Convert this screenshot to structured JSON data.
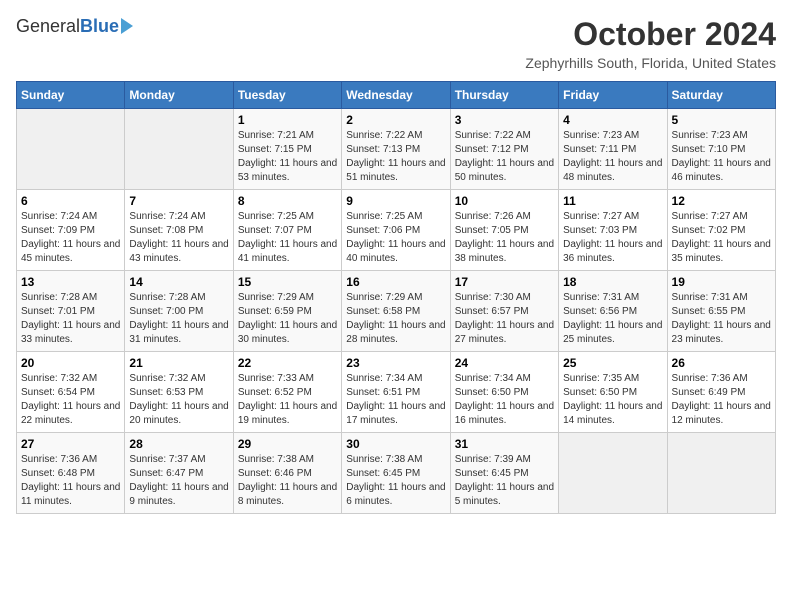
{
  "header": {
    "logo_general": "General",
    "logo_blue": "Blue",
    "month_title": "October 2024",
    "location": "Zephyrhills South, Florida, United States"
  },
  "days_of_week": [
    "Sunday",
    "Monday",
    "Tuesday",
    "Wednesday",
    "Thursday",
    "Friday",
    "Saturday"
  ],
  "weeks": [
    [
      {
        "day": "",
        "info": ""
      },
      {
        "day": "",
        "info": ""
      },
      {
        "day": "1",
        "info": "Sunrise: 7:21 AM\nSunset: 7:15 PM\nDaylight: 11 hours and 53 minutes."
      },
      {
        "day": "2",
        "info": "Sunrise: 7:22 AM\nSunset: 7:13 PM\nDaylight: 11 hours and 51 minutes."
      },
      {
        "day": "3",
        "info": "Sunrise: 7:22 AM\nSunset: 7:12 PM\nDaylight: 11 hours and 50 minutes."
      },
      {
        "day": "4",
        "info": "Sunrise: 7:23 AM\nSunset: 7:11 PM\nDaylight: 11 hours and 48 minutes."
      },
      {
        "day": "5",
        "info": "Sunrise: 7:23 AM\nSunset: 7:10 PM\nDaylight: 11 hours and 46 minutes."
      }
    ],
    [
      {
        "day": "6",
        "info": "Sunrise: 7:24 AM\nSunset: 7:09 PM\nDaylight: 11 hours and 45 minutes."
      },
      {
        "day": "7",
        "info": "Sunrise: 7:24 AM\nSunset: 7:08 PM\nDaylight: 11 hours and 43 minutes."
      },
      {
        "day": "8",
        "info": "Sunrise: 7:25 AM\nSunset: 7:07 PM\nDaylight: 11 hours and 41 minutes."
      },
      {
        "day": "9",
        "info": "Sunrise: 7:25 AM\nSunset: 7:06 PM\nDaylight: 11 hours and 40 minutes."
      },
      {
        "day": "10",
        "info": "Sunrise: 7:26 AM\nSunset: 7:05 PM\nDaylight: 11 hours and 38 minutes."
      },
      {
        "day": "11",
        "info": "Sunrise: 7:27 AM\nSunset: 7:03 PM\nDaylight: 11 hours and 36 minutes."
      },
      {
        "day": "12",
        "info": "Sunrise: 7:27 AM\nSunset: 7:02 PM\nDaylight: 11 hours and 35 minutes."
      }
    ],
    [
      {
        "day": "13",
        "info": "Sunrise: 7:28 AM\nSunset: 7:01 PM\nDaylight: 11 hours and 33 minutes."
      },
      {
        "day": "14",
        "info": "Sunrise: 7:28 AM\nSunset: 7:00 PM\nDaylight: 11 hours and 31 minutes."
      },
      {
        "day": "15",
        "info": "Sunrise: 7:29 AM\nSunset: 6:59 PM\nDaylight: 11 hours and 30 minutes."
      },
      {
        "day": "16",
        "info": "Sunrise: 7:29 AM\nSunset: 6:58 PM\nDaylight: 11 hours and 28 minutes."
      },
      {
        "day": "17",
        "info": "Sunrise: 7:30 AM\nSunset: 6:57 PM\nDaylight: 11 hours and 27 minutes."
      },
      {
        "day": "18",
        "info": "Sunrise: 7:31 AM\nSunset: 6:56 PM\nDaylight: 11 hours and 25 minutes."
      },
      {
        "day": "19",
        "info": "Sunrise: 7:31 AM\nSunset: 6:55 PM\nDaylight: 11 hours and 23 minutes."
      }
    ],
    [
      {
        "day": "20",
        "info": "Sunrise: 7:32 AM\nSunset: 6:54 PM\nDaylight: 11 hours and 22 minutes."
      },
      {
        "day": "21",
        "info": "Sunrise: 7:32 AM\nSunset: 6:53 PM\nDaylight: 11 hours and 20 minutes."
      },
      {
        "day": "22",
        "info": "Sunrise: 7:33 AM\nSunset: 6:52 PM\nDaylight: 11 hours and 19 minutes."
      },
      {
        "day": "23",
        "info": "Sunrise: 7:34 AM\nSunset: 6:51 PM\nDaylight: 11 hours and 17 minutes."
      },
      {
        "day": "24",
        "info": "Sunrise: 7:34 AM\nSunset: 6:50 PM\nDaylight: 11 hours and 16 minutes."
      },
      {
        "day": "25",
        "info": "Sunrise: 7:35 AM\nSunset: 6:50 PM\nDaylight: 11 hours and 14 minutes."
      },
      {
        "day": "26",
        "info": "Sunrise: 7:36 AM\nSunset: 6:49 PM\nDaylight: 11 hours and 12 minutes."
      }
    ],
    [
      {
        "day": "27",
        "info": "Sunrise: 7:36 AM\nSunset: 6:48 PM\nDaylight: 11 hours and 11 minutes."
      },
      {
        "day": "28",
        "info": "Sunrise: 7:37 AM\nSunset: 6:47 PM\nDaylight: 11 hours and 9 minutes."
      },
      {
        "day": "29",
        "info": "Sunrise: 7:38 AM\nSunset: 6:46 PM\nDaylight: 11 hours and 8 minutes."
      },
      {
        "day": "30",
        "info": "Sunrise: 7:38 AM\nSunset: 6:45 PM\nDaylight: 11 hours and 6 minutes."
      },
      {
        "day": "31",
        "info": "Sunrise: 7:39 AM\nSunset: 6:45 PM\nDaylight: 11 hours and 5 minutes."
      },
      {
        "day": "",
        "info": ""
      },
      {
        "day": "",
        "info": ""
      }
    ]
  ]
}
